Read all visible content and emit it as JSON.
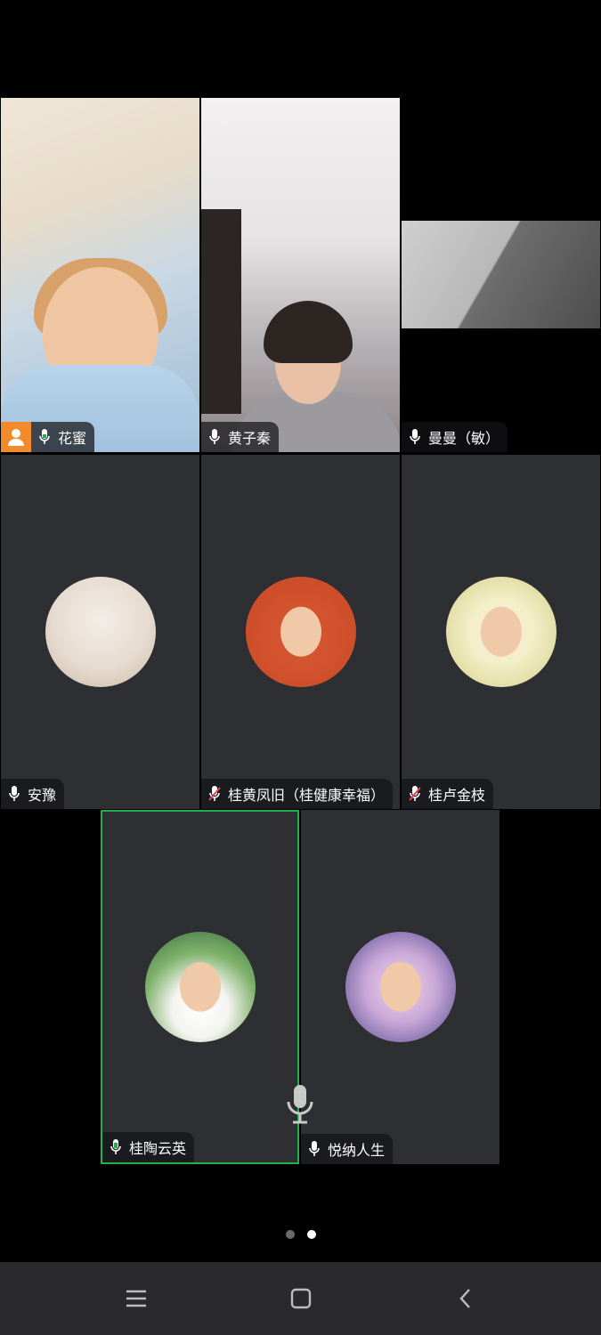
{
  "participants": [
    {
      "name": "花蜜",
      "mic": "on-active",
      "host": true
    },
    {
      "name": "黄子秦",
      "mic": "on"
    },
    {
      "name": "曼曼（敏）",
      "mic": "on"
    },
    {
      "name": "安豫",
      "mic": "on"
    },
    {
      "name": "桂黄凤旧（桂健康幸福）",
      "mic": "muted"
    },
    {
      "name": "桂卢金枝",
      "mic": "muted"
    },
    {
      "name": "桂陶云英",
      "mic": "on-active",
      "speaking": true
    },
    {
      "name": "悦纳人生",
      "mic": "on"
    }
  ],
  "pager": {
    "pages": 2,
    "current": 2
  },
  "icons": {
    "host_badge": "person-icon",
    "mic": "microphone-icon",
    "mic_muted": "microphone-muted-icon",
    "nav": [
      "menu-icon",
      "home-square-icon",
      "back-chevron-icon"
    ]
  },
  "colors": {
    "active_speaker": "#23b04a",
    "muted": "#e0464f",
    "host_badge": "#f08a2a"
  }
}
